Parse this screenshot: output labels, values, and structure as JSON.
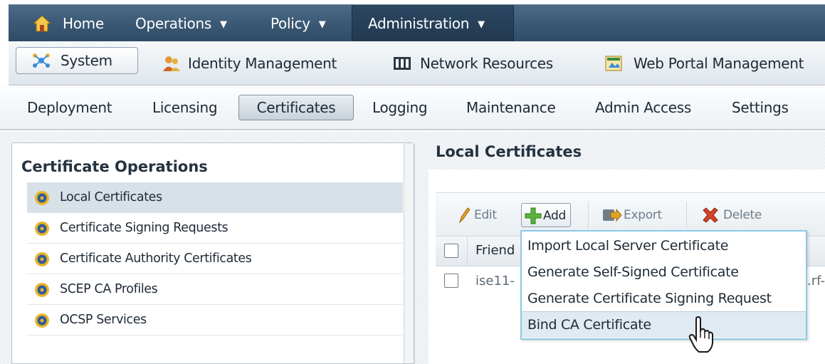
{
  "top_nav": {
    "home": "Home",
    "operations": "Operations",
    "policy": "Policy",
    "administration": "Administration"
  },
  "sub_nav": {
    "system": "System",
    "identity_management": "Identity Management",
    "network_resources": "Network Resources",
    "web_portal_management": "Web Portal Management"
  },
  "menu": {
    "deployment": "Deployment",
    "licensing": "Licensing",
    "certificates": "Certificates",
    "logging": "Logging",
    "maintenance": "Maintenance",
    "admin_access": "Admin Access",
    "settings": "Settings"
  },
  "left_panel": {
    "title": "Certificate Operations",
    "items": [
      "Local Certificates",
      "Certificate Signing Requests",
      "Certificate Authority Certificates",
      "SCEP CA Profiles",
      "OCSP Services"
    ]
  },
  "main": {
    "title": "Local Certificates",
    "toolbar": {
      "edit": "Edit",
      "add": "Add",
      "export": "Export",
      "delete": "Delete"
    },
    "table": {
      "header_friendly": "Friend",
      "row1_left": "ise11-",
      "row1_right": ".rf-"
    },
    "add_menu": [
      "Import Local Server Certificate",
      "Generate Self-Signed Certificate",
      "Generate Certificate Signing Request",
      "Bind CA Certificate"
    ]
  },
  "colors": {
    "nav_blue": "#3a5874",
    "selection": "#d9e1e8",
    "menu_border": "#8cc8e6"
  }
}
